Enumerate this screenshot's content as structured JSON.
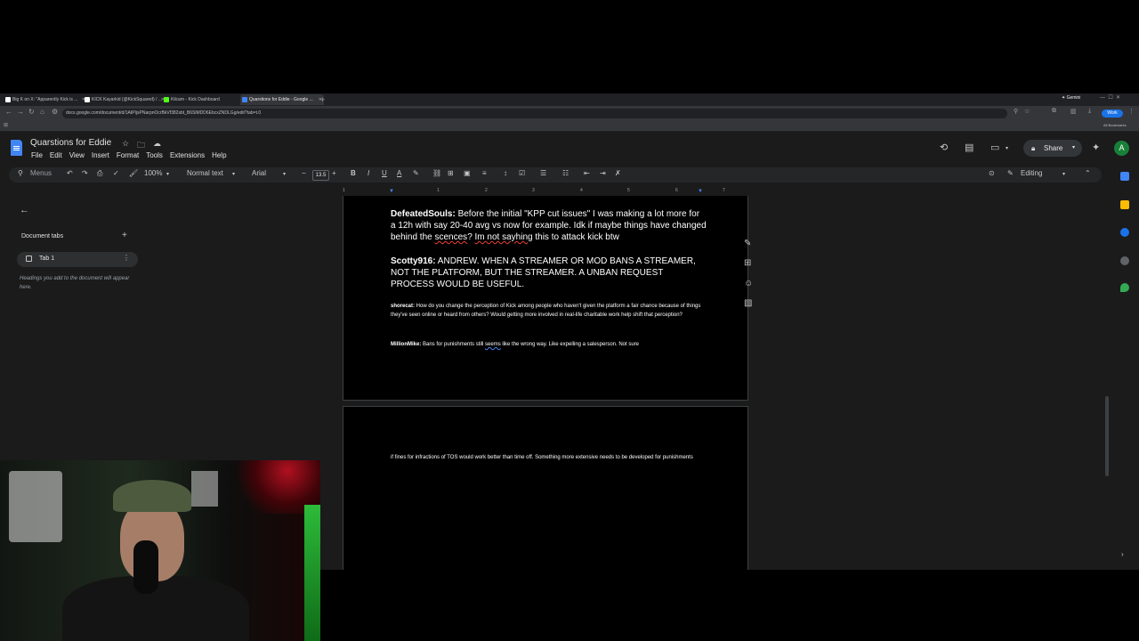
{
  "browser": {
    "tabs": [
      {
        "label": "Big K on X: \"Apparently Kick is ...",
        "favicon_color": "#ffffff",
        "active": false
      },
      {
        "label": "KICK Kayarkid (@KickSquared) / ...",
        "favicon_color": "#ffffff",
        "active": false
      },
      {
        "label": "Kilcam - Kick Dashboard",
        "favicon_color": "#53fc18",
        "active": false
      },
      {
        "label": "Quarstions for Eddie - Google ...",
        "favicon_color": "#4285f4",
        "active": true
      }
    ],
    "new_tab": "+",
    "gemini": "✦ Gemini",
    "url": "docs.google.com/document/d/1AtPIjsPNarpnOcrBkVf382sbt_B6SlMDD6EbcxZNDLGg/edit?tab=t.0",
    "work_badge": "Work",
    "all_bookmarks": "All Bookmarks"
  },
  "docs": {
    "title": "Quarstions for Eddie",
    "menus": [
      "File",
      "Edit",
      "View",
      "Insert",
      "Format",
      "Tools",
      "Extensions",
      "Help"
    ],
    "share_label": "Share",
    "avatar_letter": "A",
    "toolbar": {
      "menus_search": "Menus",
      "zoom": "100%",
      "style": "Normal text",
      "font": "Arial",
      "font_size": "13.5",
      "editing_mode": "Editing"
    },
    "ruler_ticks": [
      "1",
      "1",
      "2",
      "3",
      "4",
      "5",
      "6",
      "7"
    ],
    "sidebar": {
      "title": "Document tabs",
      "add": "+",
      "tab_label": "Tab 1",
      "note": "Headings you add to the document will appear here."
    },
    "content": {
      "p1_name": "DefeatedSouls:",
      "p1_text_a": " Before the initial \"KPP cut issues\" I was making a lot more for a 12h with say 20-40 avg vs now for example. Idk if maybe things have changed behind the ",
      "p1_spell1": "scences",
      "p1_text_b": "? ",
      "p1_spell2": "Im not sayhing",
      "p1_text_c": " this to attack kick btw",
      "p2_name": "Scotty916:",
      "p2_text": " ANDREW. WHEN A STREAMER OR MOD BANS A STREAMER, NOT THE PLATFORM, BUT THE STREAMER. A UNBAN REQUEST PROCESS WOULD BE USEFUL.",
      "p3_name": "shorecat:",
      "p3_text": " How do you change the perception of Kick among people who haven't given the platform a fair chance because of things they've seen online or heard from others? Would getting more involved in real-life charitable work help shift that perception?",
      "p4_name": "MillionMike:",
      "p4_text_a": " Bans for punishments still ",
      "p4_grammar": "seems",
      "p4_text_b": " like the wrong way. Like expelling a salesperson. Not sure",
      "p5_text": "if fines for infractions of TOS would work better than time off. Something more extensive needs to be developed for punishments"
    }
  }
}
